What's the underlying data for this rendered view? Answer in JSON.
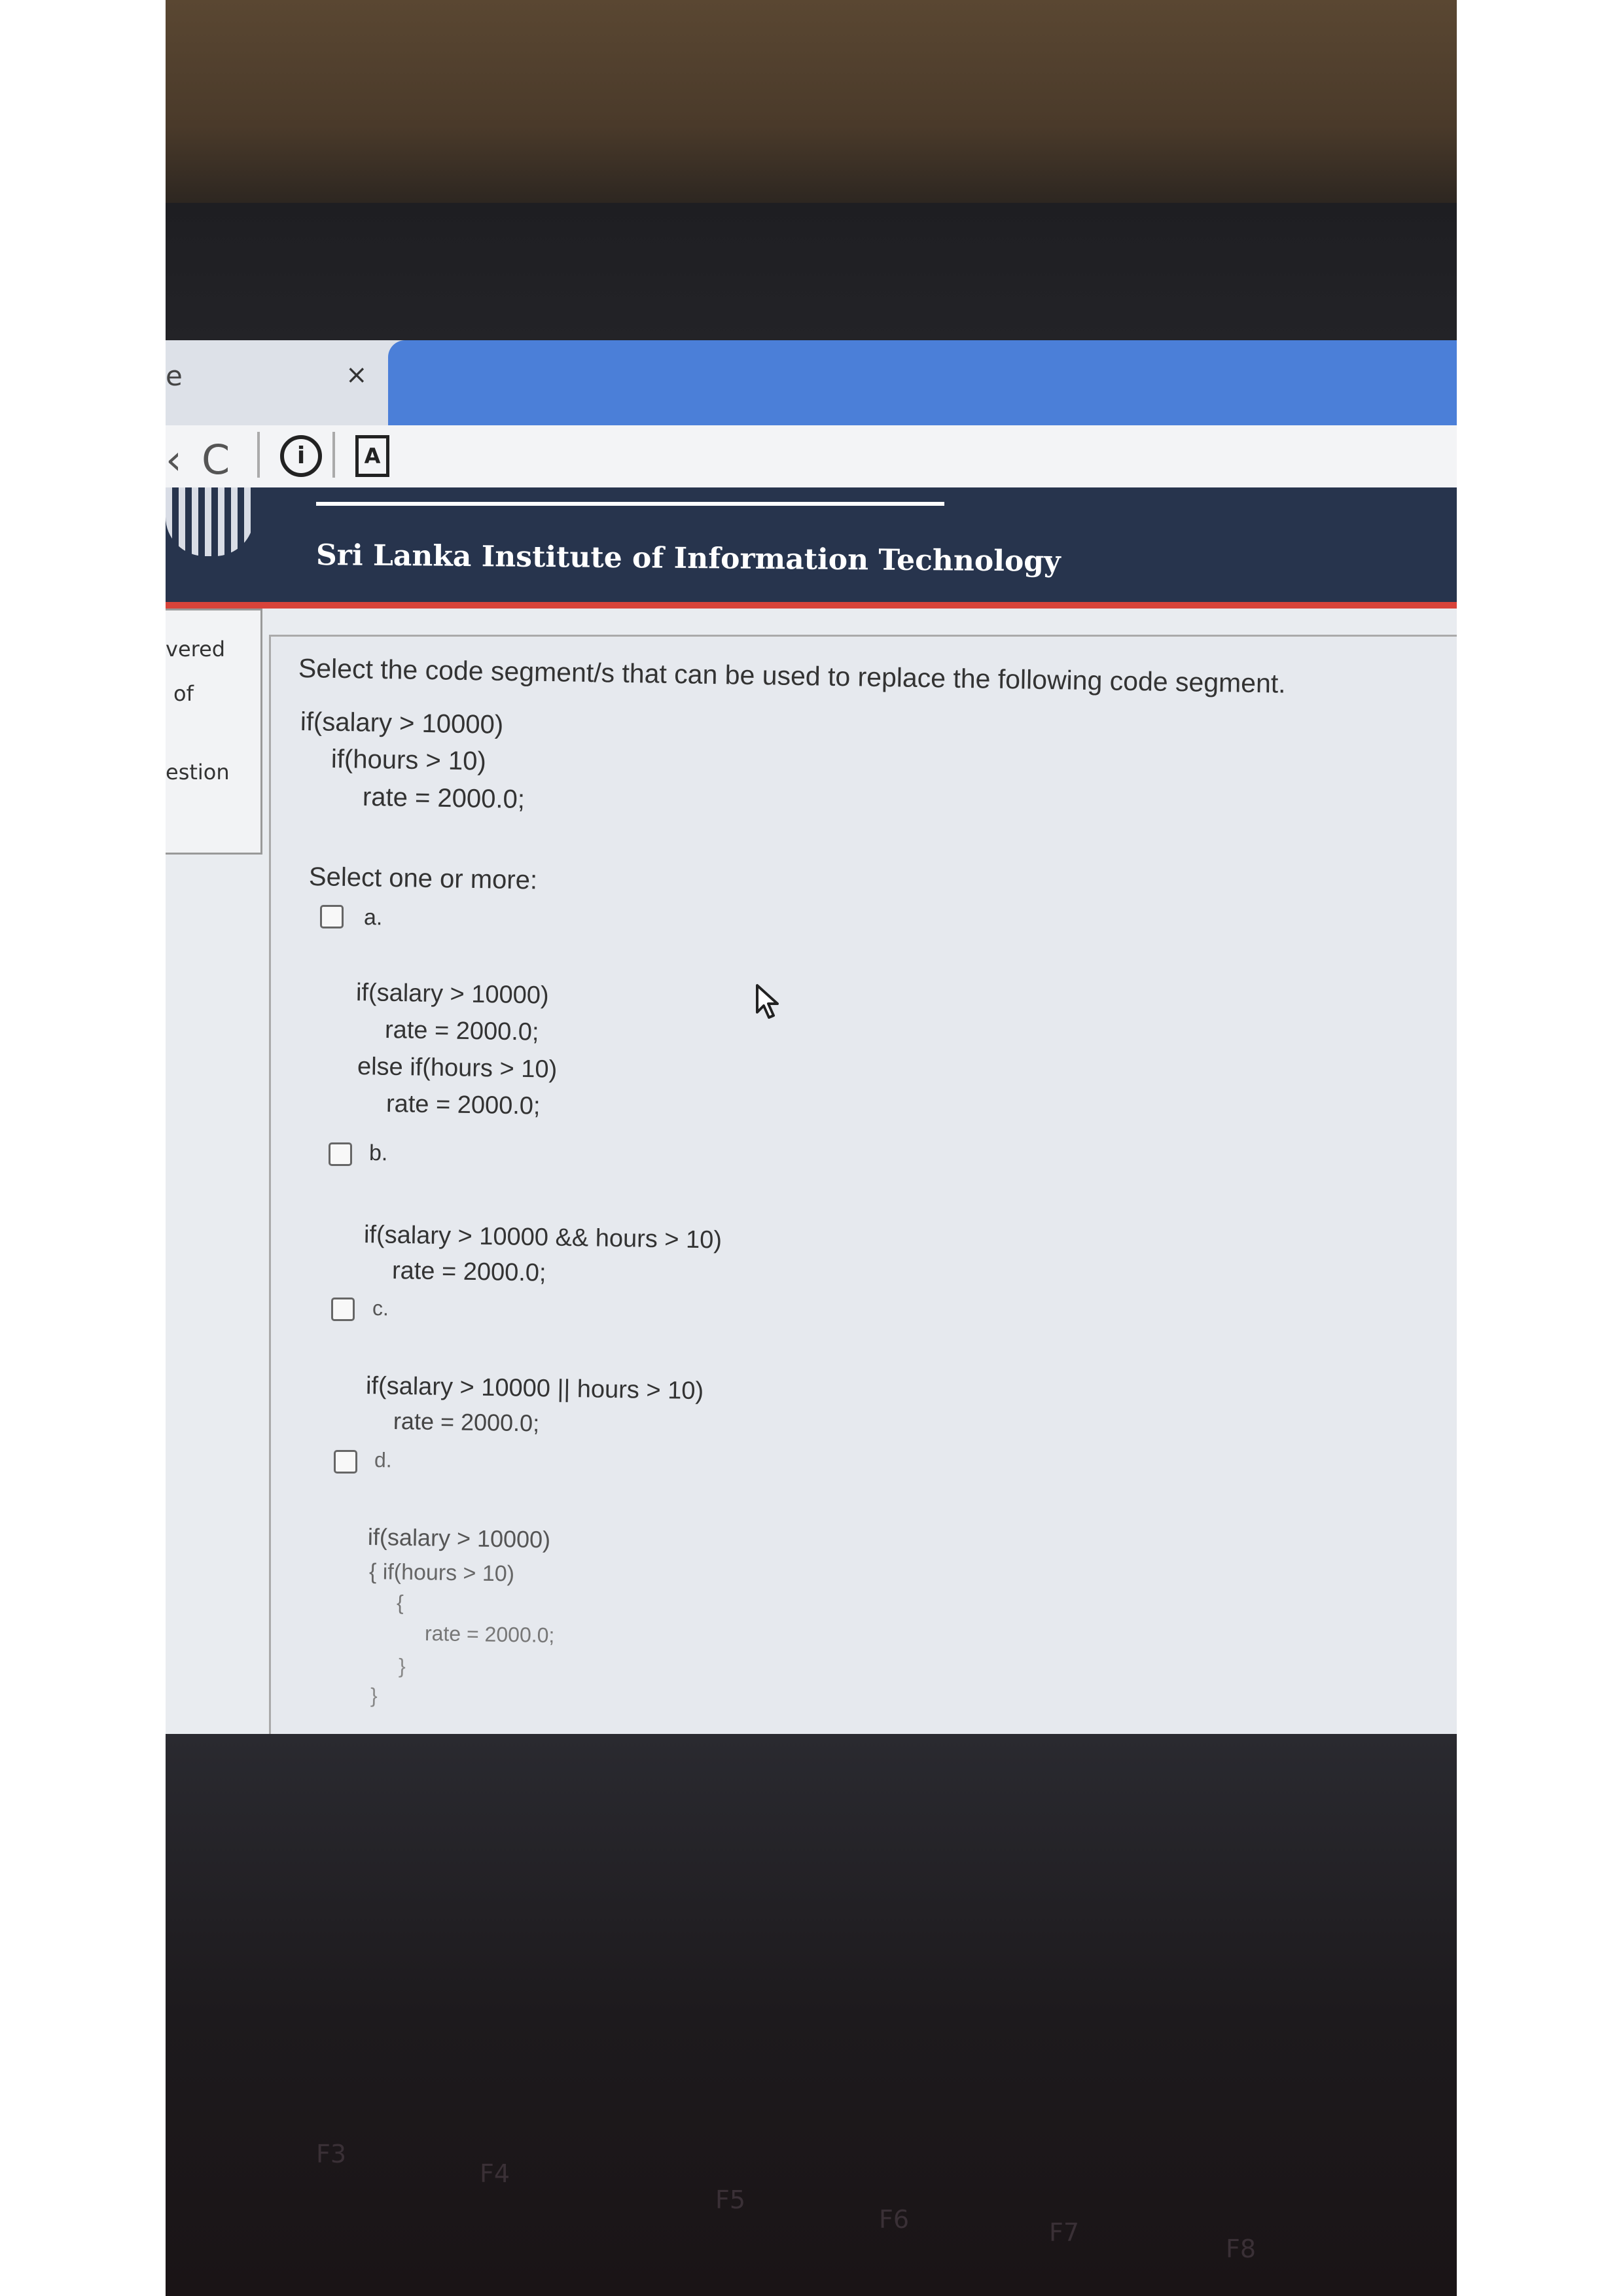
{
  "browser": {
    "tab_close": "×",
    "tab_edge": "e",
    "back": "‹",
    "reload": "C",
    "info": "i",
    "doc": "A"
  },
  "site": {
    "title": "Sri Lanka Institute of Information Technology"
  },
  "sidebar": {
    "texts": [
      "vered",
      "of",
      "estion"
    ]
  },
  "question": {
    "prompt": "Select the code segment/s that can be used to replace the following code segment.",
    "code": [
      "if(salary > 10000)",
      "if(hours > 10)",
      "rate = 2000.0;"
    ],
    "instruction": "Select one or more:",
    "options": [
      {
        "letter": "a.",
        "code": [
          "if(salary > 10000)",
          "rate = 2000.0;",
          "else if(hours > 10)",
          "rate = 2000.0;"
        ]
      },
      {
        "letter": "b.",
        "code": [
          "if(salary > 10000 && hours > 10)",
          "rate = 2000.0;"
        ]
      },
      {
        "letter": "c.",
        "code": [
          "if(salary > 10000 || hours > 10)",
          "rate = 2000.0;"
        ]
      },
      {
        "letter": "d.",
        "code": [
          "if(salary > 10000)",
          "{ if(hours > 10)",
          "{",
          "rate = 2000.0;",
          "}",
          "}"
        ]
      }
    ]
  },
  "keyboard": {
    "keys": [
      "F3",
      "F4",
      "F5",
      "F6",
      "F7",
      "F8"
    ]
  },
  "colors": {
    "header": "#27344d",
    "accent_red": "#d8433a",
    "tab_blue": "#4b7fd8"
  }
}
